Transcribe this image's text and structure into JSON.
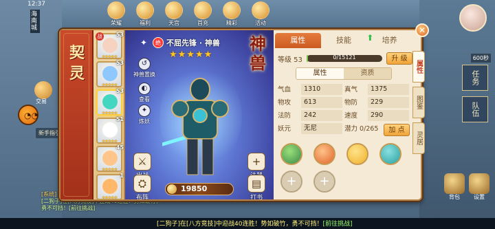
{
  "status": {
    "time": "12:37",
    "right": "100"
  },
  "top_icons": [
    {
      "label": "荣耀"
    },
    {
      "label": "福利"
    },
    {
      "label": "天宫"
    },
    {
      "label": "首充"
    },
    {
      "label": "精彩"
    },
    {
      "label": "活动"
    }
  ],
  "left_bg": {
    "city_label": "海南城",
    "menu_label": "交易",
    "guide_label": "新手指引"
  },
  "right_bg": {
    "mini_label": "600秒",
    "tab_task": "任务",
    "tab_team": "队伍",
    "bottom": [
      "背包",
      "设置"
    ]
  },
  "chat": {
    "line1": "[二狗子]在[八方竞技]中迎战40连胜！势如破竹，勇不可挡！[前往挑战]",
    "line2": "[系统]"
  },
  "ticker": {
    "prefix": "[二狗子]在[八方竞技]中迎战40连胜！势如破竹，勇不可挡！",
    "link": "[前往挑战]"
  },
  "dialog": {
    "title": "契灵",
    "close_label": "✕",
    "roster": [
      {
        "level": "53",
        "stars": "★★★★★",
        "badge": "战",
        "face": "#f6d3c0"
      },
      {
        "level": "53",
        "stars": "★★★★★",
        "badge": "",
        "face": "#8fc7ff"
      },
      {
        "level": "53",
        "stars": "★★★★★",
        "badge": "",
        "face": "#44d6c0"
      },
      {
        "level": "51",
        "stars": "★★★★★",
        "badge": "",
        "face": "#ffffff"
      },
      {
        "level": "45",
        "stars": "★★★★★",
        "badge": "",
        "face": "#ffc58a"
      },
      {
        "level": "1",
        "stars": "★★★★★",
        "badge": "",
        "face": "#ffb86a"
      }
    ],
    "pet": {
      "rank": "绝",
      "name": "不屈先锋 · 神兽",
      "stars": "★★★★★",
      "title": "神兽",
      "power": "19850"
    },
    "left_actions": [
      {
        "icon": "↺",
        "label": "神兽置换"
      },
      {
        "icon": "◐",
        "label": "查看"
      },
      {
        "icon": "✦",
        "label": "炼妖"
      }
    ],
    "bottom_actions": [
      {
        "icon": "⚔",
        "label": "出战"
      },
      {
        "icon": "⛭",
        "label": "布阵"
      },
      {
        "icon": "+",
        "label": "法器"
      },
      {
        "icon": "▤",
        "label": "打书"
      }
    ],
    "tabs": [
      {
        "label": "属性"
      },
      {
        "label": "技能"
      },
      {
        "label": "培养"
      }
    ],
    "level": {
      "label": "等级 53",
      "progress_text": "0/15121",
      "progress": 0.02,
      "upgrade_label": "升 级"
    },
    "subtabs": [
      {
        "label": "属性"
      },
      {
        "label": "资质"
      }
    ],
    "stats": [
      [
        {
          "k": "气血",
          "v": "1310"
        },
        {
          "k": "真气",
          "v": "1375"
        }
      ],
      [
        {
          "k": "物攻",
          "v": "613"
        },
        {
          "k": "物防",
          "v": "229"
        }
      ],
      [
        {
          "k": "法防",
          "v": "242"
        },
        {
          "k": "速度",
          "v": "290"
        }
      ]
    ],
    "yuan": {
      "k": "妖元",
      "v": "无尼"
    },
    "potential": {
      "text": "潜力 0/265",
      "add_label": "加 点"
    },
    "skills": [
      {
        "color": "#3a8a4a"
      },
      {
        "color": "#e0642a"
      },
      {
        "color": "#f0b02a"
      },
      {
        "color": "#2aa0a0"
      }
    ],
    "skill_empty_icon": "+",
    "vtabs": [
      {
        "label": "属性"
      },
      {
        "label": "图鉴"
      },
      {
        "label": "灵居"
      }
    ]
  }
}
